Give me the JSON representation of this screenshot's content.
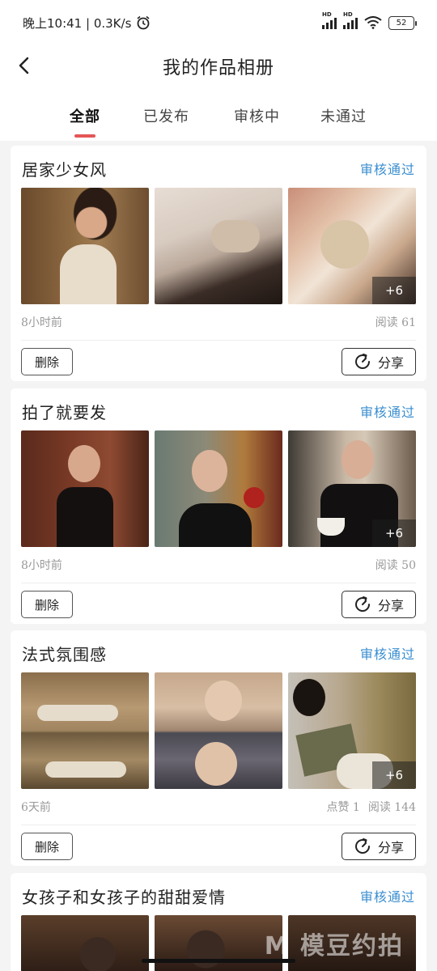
{
  "status_bar": {
    "time_speed": "晚上10:41 | 0.3K/s",
    "signal_label_1": "HD",
    "signal_label_2": "HD",
    "battery": "52"
  },
  "header": {
    "title": "我的作品相册"
  },
  "tabs": [
    {
      "label": "全部",
      "active": true
    },
    {
      "label": "已发布",
      "active": false
    },
    {
      "label": "审核中",
      "active": false
    },
    {
      "label": "未通过",
      "active": false
    }
  ],
  "albums": [
    {
      "title": "居家少女风",
      "status": "审核通过",
      "more_count": "+6",
      "time": "8小时前",
      "likes": "",
      "reads": "阅读 61",
      "delete_label": "删除",
      "share_label": "分享"
    },
    {
      "title": "拍了就要发",
      "status": "审核通过",
      "more_count": "+6",
      "time": "8小时前",
      "likes": "",
      "reads": "阅读 50",
      "delete_label": "删除",
      "share_label": "分享"
    },
    {
      "title": "法式氛围感",
      "status": "审核通过",
      "more_count": "+6",
      "time": "6天前",
      "likes": "点赞 1",
      "reads": "阅读 144",
      "delete_label": "删除",
      "share_label": "分享"
    },
    {
      "title": "女孩子和女孩子的甜甜爱情",
      "status": "审核通过"
    }
  ],
  "watermark": "M 模豆约拍",
  "colors": {
    "accent_red": "#e45656",
    "status_blue": "#3a8ed0"
  }
}
